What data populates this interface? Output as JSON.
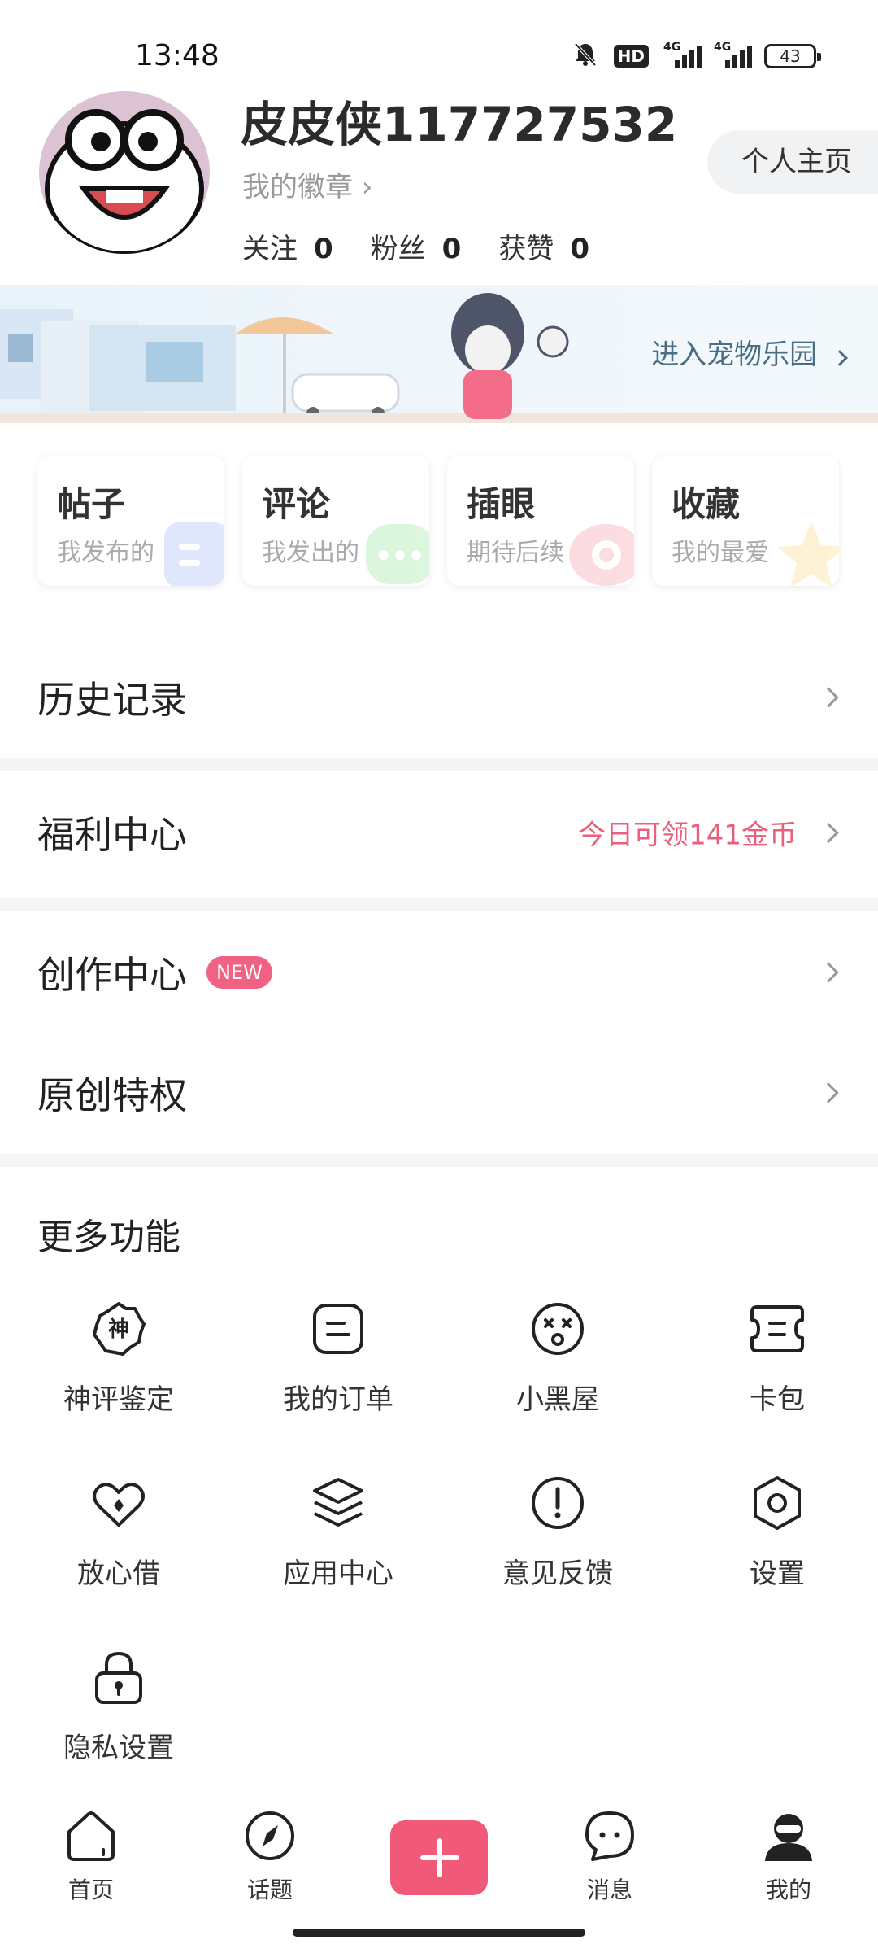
{
  "status_bar": {
    "time": "13:48",
    "hd_label": "HD",
    "network_1": "4G",
    "network_2": "4G",
    "battery": "43"
  },
  "profile": {
    "username": "皮皮侠117727532",
    "badge_link": "我的徽章 ›",
    "stats": [
      {
        "label": "关注",
        "value": "0"
      },
      {
        "label": "粉丝",
        "value": "0"
      },
      {
        "label": "获赞",
        "value": "0"
      }
    ],
    "home_button": "个人主页"
  },
  "banner": {
    "text": "进入宠物乐园"
  },
  "tiles": [
    {
      "title": "帖子",
      "sub": "我发布的",
      "icon": "note-icon",
      "color": "#c8d3f8"
    },
    {
      "title": "评论",
      "sub": "我发出的",
      "icon": "chat-bubble-icon",
      "color": "#bff0c3"
    },
    {
      "title": "插眼",
      "sub": "期待后续",
      "icon": "eye-icon",
      "color": "#f9c1ca"
    },
    {
      "title": "收藏",
      "sub": "我的最爱",
      "icon": "star-icon",
      "color": "#fde9b3"
    }
  ],
  "menu": {
    "history": "历史记录",
    "welfare": "福利中心",
    "welfare_promo": "今日可领141金币",
    "creation": "创作中心",
    "creation_badge": "NEW",
    "original": "原创特权"
  },
  "more": {
    "title": "更多功能",
    "items": [
      {
        "label": "神评鉴定",
        "icon": "shen-badge-icon"
      },
      {
        "label": "我的订单",
        "icon": "order-icon"
      },
      {
        "label": "小黑屋",
        "icon": "dizzy-face-icon"
      },
      {
        "label": "卡包",
        "icon": "card-wallet-icon"
      },
      {
        "label": "放心借",
        "icon": "loan-icon"
      },
      {
        "label": "应用中心",
        "icon": "layers-icon"
      },
      {
        "label": "意见反馈",
        "icon": "feedback-icon"
      },
      {
        "label": "设置",
        "icon": "settings-icon"
      },
      {
        "label": "隐私设置",
        "icon": "lock-icon"
      }
    ]
  },
  "nav": {
    "home": "首页",
    "topics": "话题",
    "messages": "消息",
    "mine": "我的"
  },
  "colors": {
    "accent": "#f05a78",
    "promo": "#ea5f7b"
  }
}
